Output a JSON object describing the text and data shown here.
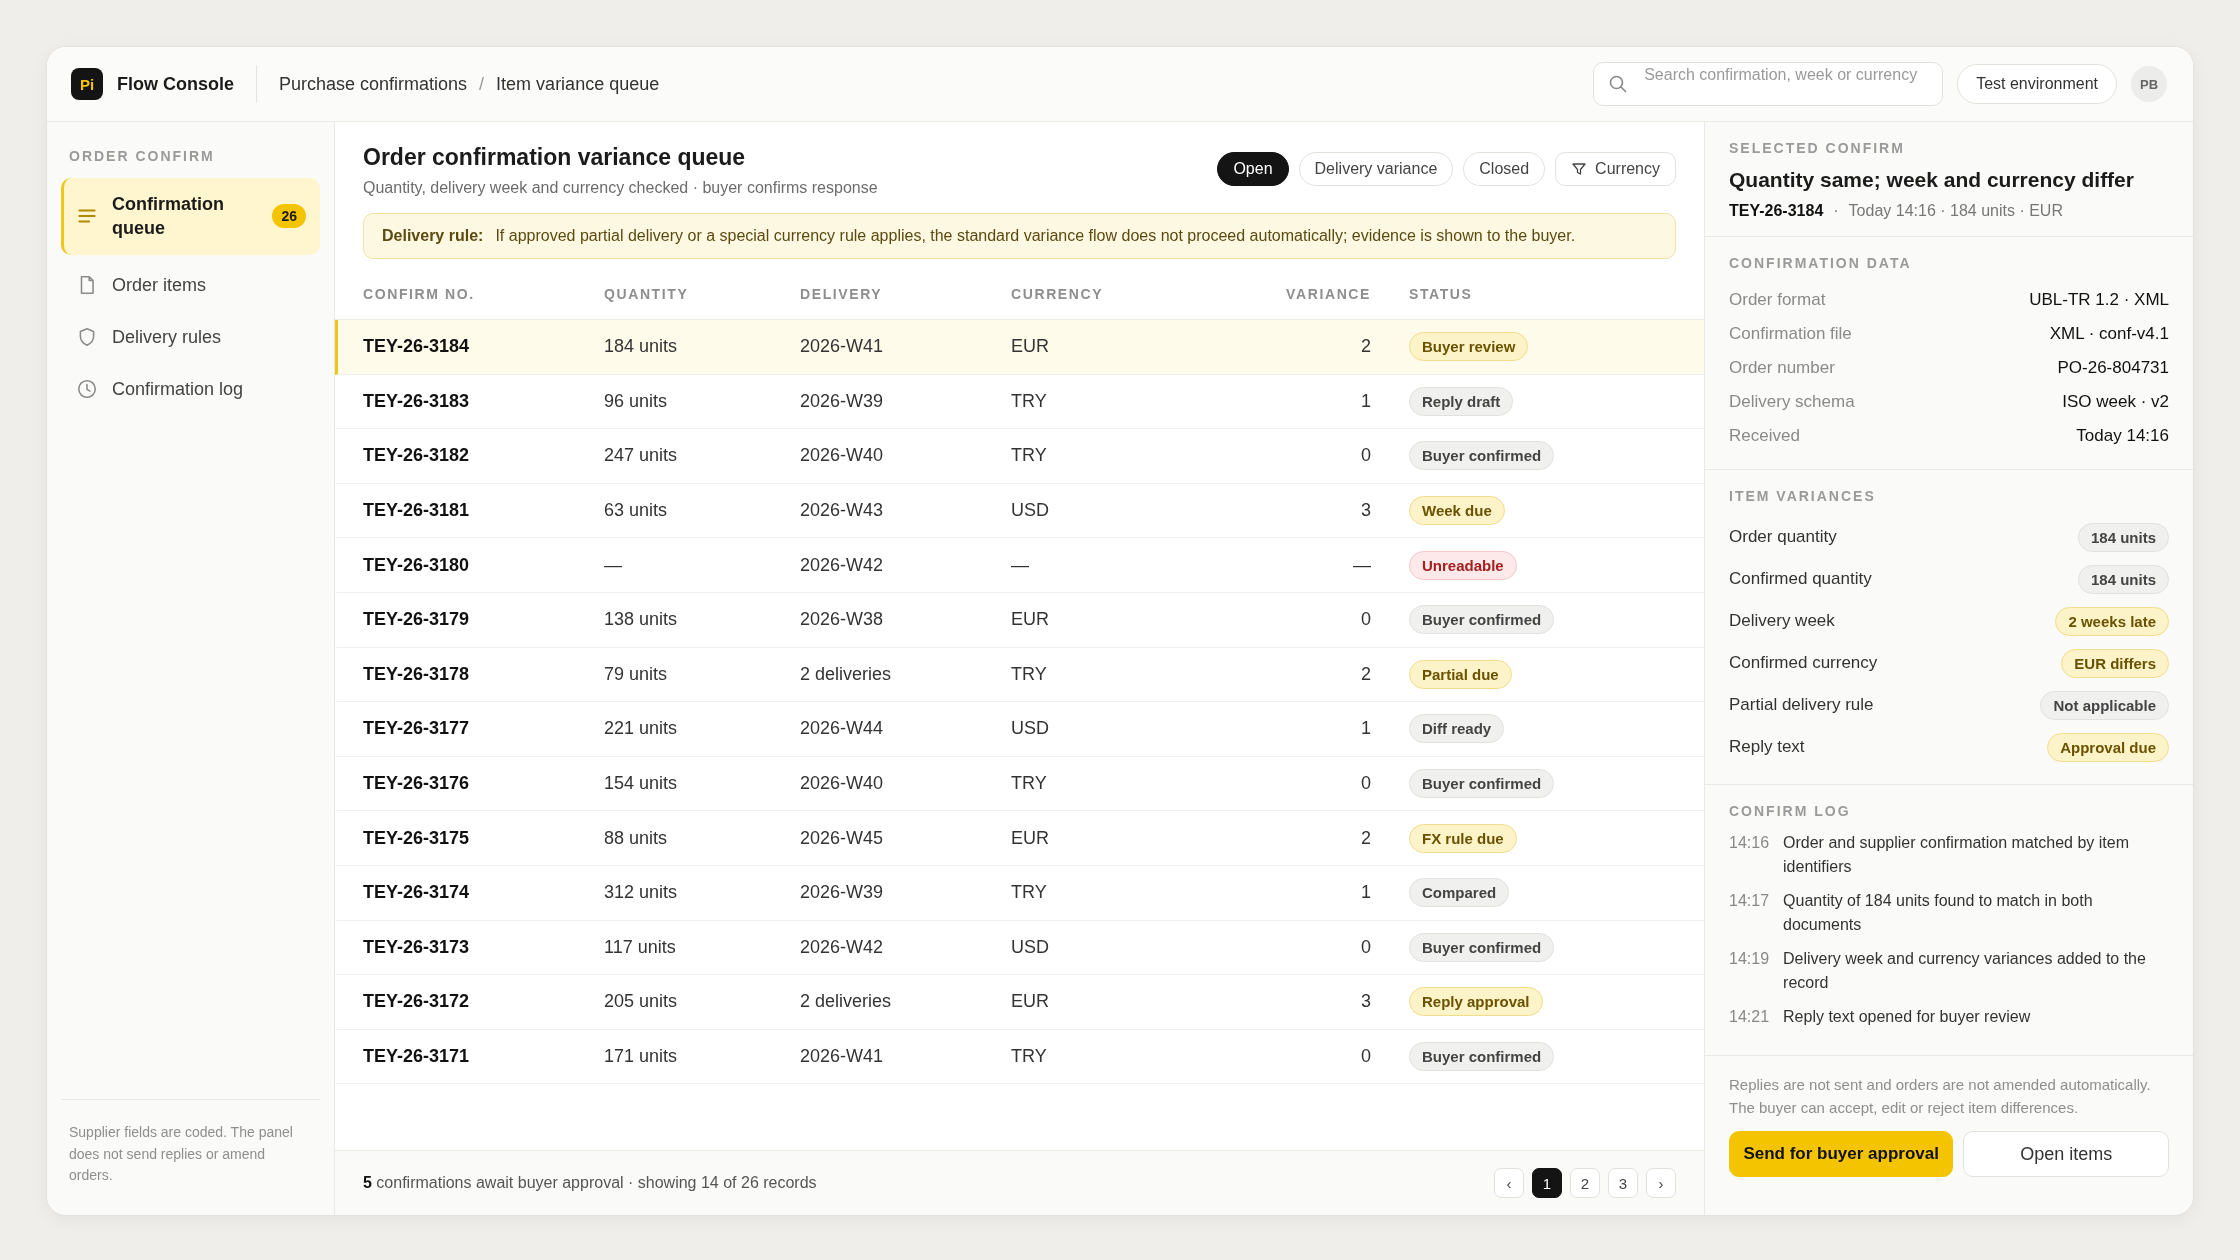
{
  "app": {
    "logo": "Pi",
    "name": "Flow Console"
  },
  "breadcrumb": [
    "Purchase confirmations",
    "Item variance queue"
  ],
  "breadcrumb_separator": "/",
  "search": {
    "placeholder": "Search confirmation, week or currency"
  },
  "environment": "Test environment",
  "avatar": "PB",
  "sidebar": {
    "section": "ORDER CONFIRM",
    "items": [
      {
        "label": "Confirmation queue",
        "selected": true,
        "badge": "26"
      },
      {
        "label": "Order items",
        "selected": false
      },
      {
        "label": "Delivery rules",
        "selected": false
      },
      {
        "label": "Confirmation log",
        "selected": false
      }
    ],
    "note": "Supplier fields are coded. The panel does not send replies or amend orders."
  },
  "main": {
    "title": "Order confirmation variance queue",
    "subtitle": "Quantity, delivery week and currency checked · buyer confirms response",
    "filters": [
      {
        "label": "Open",
        "kind": "toggle",
        "selected": true
      },
      {
        "label": "Delivery variance",
        "kind": "toggle",
        "selected": false
      },
      {
        "label": "Closed",
        "kind": "toggle",
        "selected": false
      },
      {
        "label": "Currency",
        "kind": "filter",
        "selected": false
      }
    ],
    "notice": {
      "label": "Delivery rule:",
      "text": "If approved partial delivery or a special currency rule applies, the standard variance flow does not proceed automatically; evidence is shown to the buyer."
    },
    "table": {
      "columns": [
        "CONFIRM NO.",
        "QUANTITY",
        "DELIVERY",
        "CURRENCY",
        "VARIANCE",
        "STATUS"
      ],
      "rows": [
        {
          "id": "TEY-26-3184",
          "quantity": "184 units",
          "delivery": "2026-W41",
          "currency": "EUR",
          "variance": "2",
          "status": "Buyer review",
          "kind": "warn",
          "selected": true
        },
        {
          "id": "TEY-26-3183",
          "quantity": "96 units",
          "delivery": "2026-W39",
          "currency": "TRY",
          "variance": "1",
          "status": "Reply draft",
          "kind": "neutral",
          "selected": false
        },
        {
          "id": "TEY-26-3182",
          "quantity": "247 units",
          "delivery": "2026-W40",
          "currency": "TRY",
          "variance": "0",
          "status": "Buyer confirmed",
          "kind": "neutral",
          "selected": false
        },
        {
          "id": "TEY-26-3181",
          "quantity": "63 units",
          "delivery": "2026-W43",
          "currency": "USD",
          "variance": "3",
          "status": "Week due",
          "kind": "warn",
          "selected": false
        },
        {
          "id": "TEY-26-3180",
          "quantity": "—",
          "delivery": "2026-W42",
          "currency": "—",
          "variance": "—",
          "status": "Unreadable",
          "kind": "danger",
          "selected": false
        },
        {
          "id": "TEY-26-3179",
          "quantity": "138 units",
          "delivery": "2026-W38",
          "currency": "EUR",
          "variance": "0",
          "status": "Buyer confirmed",
          "kind": "neutral",
          "selected": false
        },
        {
          "id": "TEY-26-3178",
          "quantity": "79 units",
          "delivery": "2 deliveries",
          "currency": "TRY",
          "variance": "2",
          "status": "Partial due",
          "kind": "warn",
          "selected": false
        },
        {
          "id": "TEY-26-3177",
          "quantity": "221 units",
          "delivery": "2026-W44",
          "currency": "USD",
          "variance": "1",
          "status": "Diff ready",
          "kind": "neutral",
          "selected": false
        },
        {
          "id": "TEY-26-3176",
          "quantity": "154 units",
          "delivery": "2026-W40",
          "currency": "TRY",
          "variance": "0",
          "status": "Buyer confirmed",
          "kind": "neutral",
          "selected": false
        },
        {
          "id": "TEY-26-3175",
          "quantity": "88 units",
          "delivery": "2026-W45",
          "currency": "EUR",
          "variance": "2",
          "status": "FX rule due",
          "kind": "warn",
          "selected": false
        },
        {
          "id": "TEY-26-3174",
          "quantity": "312 units",
          "delivery": "2026-W39",
          "currency": "TRY",
          "variance": "1",
          "status": "Compared",
          "kind": "neutral",
          "selected": false
        },
        {
          "id": "TEY-26-3173",
          "quantity": "117 units",
          "delivery": "2026-W42",
          "currency": "USD",
          "variance": "0",
          "status": "Buyer confirmed",
          "kind": "neutral",
          "selected": false
        },
        {
          "id": "TEY-26-3172",
          "quantity": "205 units",
          "delivery": "2 deliveries",
          "currency": "EUR",
          "variance": "3",
          "status": "Reply approval",
          "kind": "warn",
          "selected": false
        },
        {
          "id": "TEY-26-3171",
          "quantity": "171 units",
          "delivery": "2026-W41",
          "currency": "TRY",
          "variance": "0",
          "status": "Buyer confirmed",
          "kind": "neutral",
          "selected": false
        }
      ]
    },
    "footer": "**5** confirmations await buyer approval · showing 14 of 26 records",
    "pagination": {
      "prev": "‹",
      "next": "›",
      "pages": [
        {
          "label": "1",
          "selected": true
        },
        {
          "label": "2",
          "selected": false
        },
        {
          "label": "3",
          "selected": false
        }
      ]
    }
  },
  "detail": {
    "section": "SELECTED CONFIRM",
    "title": "Quantity same; week and currency differ",
    "id": "TEY-26-3184",
    "separator": "·",
    "meta": "Today 14:16 · 184 units · EUR",
    "data_section": "CONFIRMATION DATA",
    "data": [
      {
        "label": "Order format",
        "value": "UBL-TR 1.2 · XML"
      },
      {
        "label": "Confirmation file",
        "value": "XML · conf-v4.1"
      },
      {
        "label": "Order number",
        "value": "PO-26-804731"
      },
      {
        "label": "Delivery schema",
        "value": "ISO week · v2"
      },
      {
        "label": "Received",
        "value": "Today 14:16"
      }
    ],
    "variances_section": "ITEM VARIANCES",
    "variances": [
      {
        "label": "Order quantity",
        "value": "184 units",
        "kind": "neutral"
      },
      {
        "label": "Confirmed quantity",
        "value": "184 units",
        "kind": "neutral"
      },
      {
        "label": "Delivery week",
        "value": "2 weeks late",
        "kind": "warn"
      },
      {
        "label": "Confirmed currency",
        "value": "EUR differs",
        "kind": "warn"
      },
      {
        "label": "Partial delivery rule",
        "value": "Not applicable",
        "kind": "neutral"
      },
      {
        "label": "Reply text",
        "value": "Approval due",
        "kind": "warn"
      }
    ],
    "log_section": "CONFIRM LOG",
    "log": [
      {
        "time": "14:16",
        "text": "Order and supplier confirmation matched by item identifiers"
      },
      {
        "time": "14:17",
        "text": "Quantity of 184 units found to match in both documents"
      },
      {
        "time": "14:19",
        "text": "Delivery week and currency variances added to the record"
      },
      {
        "time": "14:21",
        "text": "Reply text opened for buyer review"
      }
    ],
    "note": "Replies are not sent and orders are not amended automatically. The buyer can accept, edit or reject item differences.",
    "buttons": [
      {
        "label": "Send for buyer approval",
        "kind": "primary"
      },
      {
        "label": "Open items",
        "kind": "secondary"
      }
    ]
  }
}
